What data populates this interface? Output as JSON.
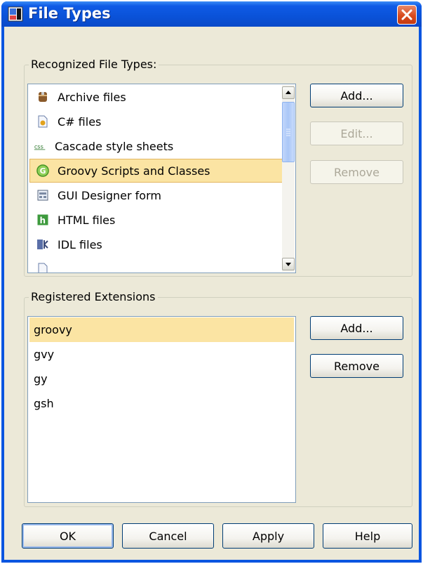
{
  "window": {
    "title": "File Types",
    "app_icon": "intellij-icon",
    "close_icon": "close-icon"
  },
  "recognized": {
    "legend": "Recognized File Types:",
    "items": [
      {
        "label": "Archive files",
        "icon": "archive-icon"
      },
      {
        "label": "C# files",
        "icon": "csharp-file-icon"
      },
      {
        "label": "Cascade style sheets",
        "icon": "css-icon"
      },
      {
        "label": "Groovy Scripts and Classes",
        "icon": "groovy-icon",
        "selected": true
      },
      {
        "label": "GUI Designer form",
        "icon": "form-icon"
      },
      {
        "label": "HTML files",
        "icon": "html-icon"
      },
      {
        "label": "IDL files",
        "icon": "idl-icon"
      }
    ],
    "buttons": {
      "add": "Add...",
      "edit": "Edit...",
      "remove": "Remove"
    }
  },
  "extensions": {
    "legend": "Registered Extensions",
    "items": [
      "groovy",
      "gvy",
      "gy",
      "gsh"
    ],
    "selected": "groovy",
    "buttons": {
      "add": "Add...",
      "remove": "Remove"
    }
  },
  "footer": {
    "ok": "OK",
    "cancel": "Cancel",
    "apply": "Apply",
    "help": "Help"
  },
  "colors": {
    "selection": "#fbe4a3",
    "titlebar": "#0a55e0",
    "dialog_bg": "#ece9d8"
  }
}
